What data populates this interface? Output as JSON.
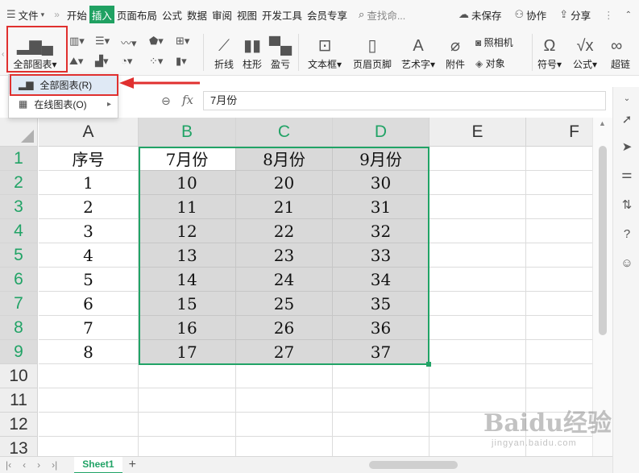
{
  "menubar": {
    "file": "文件",
    "more": "»",
    "tabs": [
      "开始",
      "插入",
      "页面布局",
      "公式",
      "数据",
      "审阅",
      "视图",
      "开发工具",
      "会员专享"
    ],
    "active_tab": "插入",
    "search": "查找命...",
    "save_status": "未保存",
    "collab": "协作",
    "share": "分享",
    "more_menu": "⋮"
  },
  "ribbon": {
    "all_charts": "全部图表",
    "line": "折线",
    "column": "柱形",
    "winloss": "盈亏",
    "textbox": "文本框",
    "header_footer": "页眉页脚",
    "wordart": "艺术字",
    "attachment": "附件",
    "camera": "照相机",
    "object": "对象",
    "symbol": "符号",
    "formula": "公式",
    "hyperlink": "超链"
  },
  "dropdown": {
    "items": [
      {
        "label": "全部图表(R)"
      },
      {
        "label": "在线图表(O)"
      }
    ]
  },
  "formula_bar": {
    "fx": "fx",
    "value": "7月份"
  },
  "grid": {
    "columns": [
      "A",
      "B",
      "C",
      "D",
      "E",
      "F"
    ],
    "rows": [
      "1",
      "2",
      "3",
      "4",
      "5",
      "6",
      "7",
      "8",
      "9",
      "10",
      "11",
      "12",
      "13"
    ],
    "cells": [
      [
        "序号",
        "7月份",
        "8月份",
        "9月份"
      ],
      [
        "1",
        "10",
        "20",
        "30"
      ],
      [
        "2",
        "11",
        "21",
        "31"
      ],
      [
        "3",
        "12",
        "22",
        "32"
      ],
      [
        "4",
        "13",
        "23",
        "33"
      ],
      [
        "5",
        "14",
        "24",
        "34"
      ],
      [
        "6",
        "15",
        "25",
        "35"
      ],
      [
        "7",
        "16",
        "26",
        "36"
      ],
      [
        "8",
        "17",
        "27",
        "37"
      ]
    ]
  },
  "sheetbar": {
    "sheet_name": "Sheet1",
    "add": "+"
  },
  "watermark": {
    "big": "Baidu经验",
    "small": "jingyan.baidu.com"
  },
  "colors": {
    "accent": "#21a366",
    "highlight": "#e0302f"
  }
}
